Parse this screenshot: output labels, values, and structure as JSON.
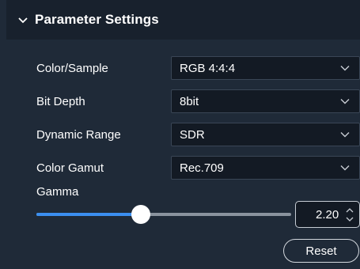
{
  "panel": {
    "title": "Parameter Settings",
    "collapse_icon": "chevron-down-icon"
  },
  "settings": [
    {
      "label": "Color/Sample",
      "value": "RGB 4:4:4",
      "icon": "chevron-down-icon"
    },
    {
      "label": "Bit Depth",
      "value": "8bit",
      "icon": "chevron-down-icon"
    },
    {
      "label": "Dynamic Range",
      "value": "SDR",
      "icon": "chevron-down-icon"
    },
    {
      "label": "Color Gamut",
      "value": "Rec.709",
      "icon": "chevron-down-icon"
    }
  ],
  "gamma": {
    "label": "Gamma",
    "value": "2.20",
    "slider_fraction": 0.41,
    "stepper_icons": [
      "chevron-up-icon",
      "chevron-down-icon"
    ]
  },
  "reset_label": "Reset",
  "colors": {
    "panel_bg": "#1f2a38",
    "header_bg": "#18212d",
    "select_bg": "#131a24",
    "accent": "#3b8ff0"
  }
}
